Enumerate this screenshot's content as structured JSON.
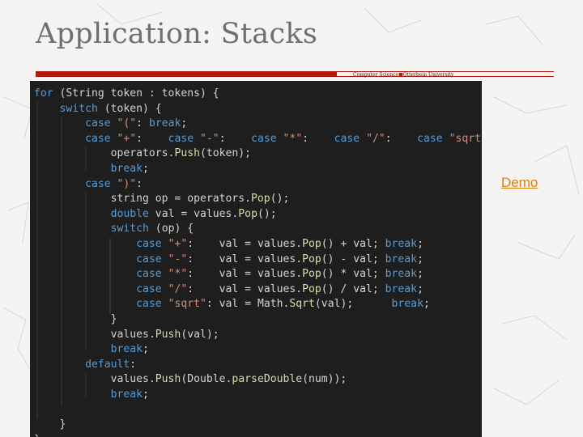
{
  "slide": {
    "title": "Application: Stacks",
    "university_left": "Computer Science",
    "university_sep": "■",
    "university_right": "Otterbein University",
    "demo_link": "Demo"
  },
  "code": {
    "lines": [
      [
        {
          "t": "kw",
          "v": "for"
        },
        {
          "t": "pl",
          "v": " (String token : tokens) {"
        }
      ],
      [
        {
          "t": "pl",
          "v": "    "
        },
        {
          "t": "kw",
          "v": "switch"
        },
        {
          "t": "pl",
          "v": " (token) {"
        }
      ],
      [
        {
          "t": "pl",
          "v": "        "
        },
        {
          "t": "kw",
          "v": "case"
        },
        {
          "t": "pl",
          "v": " "
        },
        {
          "t": "str",
          "v": "\"(\""
        },
        {
          "t": "pl",
          "v": ": "
        },
        {
          "t": "kw",
          "v": "break"
        },
        {
          "t": "pl",
          "v": ";"
        }
      ],
      [
        {
          "t": "pl",
          "v": "        "
        },
        {
          "t": "kw",
          "v": "case"
        },
        {
          "t": "pl",
          "v": " "
        },
        {
          "t": "str",
          "v": "\"+\""
        },
        {
          "t": "pl",
          "v": ":    "
        },
        {
          "t": "kw",
          "v": "case"
        },
        {
          "t": "pl",
          "v": " "
        },
        {
          "t": "str",
          "v": "\"-\""
        },
        {
          "t": "pl",
          "v": ":    "
        },
        {
          "t": "kw",
          "v": "case"
        },
        {
          "t": "pl",
          "v": " "
        },
        {
          "t": "str",
          "v": "\"*\""
        },
        {
          "t": "pl",
          "v": ":    "
        },
        {
          "t": "kw",
          "v": "case"
        },
        {
          "t": "pl",
          "v": " "
        },
        {
          "t": "str",
          "v": "\"/\""
        },
        {
          "t": "pl",
          "v": ":    "
        },
        {
          "t": "kw",
          "v": "case"
        },
        {
          "t": "pl",
          "v": " "
        },
        {
          "t": "str",
          "v": "\"sqrt\""
        },
        {
          "t": "pl",
          "v": ":"
        }
      ],
      [
        {
          "t": "pl",
          "v": "            operators."
        },
        {
          "t": "fn",
          "v": "Push"
        },
        {
          "t": "pl",
          "v": "(token);"
        }
      ],
      [
        {
          "t": "pl",
          "v": "            "
        },
        {
          "t": "kw",
          "v": "break"
        },
        {
          "t": "pl",
          "v": ";"
        }
      ],
      [
        {
          "t": "pl",
          "v": "        "
        },
        {
          "t": "kw",
          "v": "case"
        },
        {
          "t": "pl",
          "v": " "
        },
        {
          "t": "str",
          "v": "\")\""
        },
        {
          "t": "pl",
          "v": ":"
        }
      ],
      [
        {
          "t": "pl",
          "v": "            string op = operators."
        },
        {
          "t": "fn",
          "v": "Pop"
        },
        {
          "t": "pl",
          "v": "();"
        }
      ],
      [
        {
          "t": "pl",
          "v": "            "
        },
        {
          "t": "kw",
          "v": "double"
        },
        {
          "t": "pl",
          "v": " val = values."
        },
        {
          "t": "fn",
          "v": "Pop"
        },
        {
          "t": "pl",
          "v": "();"
        }
      ],
      [
        {
          "t": "pl",
          "v": "            "
        },
        {
          "t": "kw",
          "v": "switch"
        },
        {
          "t": "pl",
          "v": " (op) {"
        }
      ],
      [
        {
          "t": "pl",
          "v": "                "
        },
        {
          "t": "kw",
          "v": "case"
        },
        {
          "t": "pl",
          "v": " "
        },
        {
          "t": "str",
          "v": "\"+\""
        },
        {
          "t": "pl",
          "v": ":    val = values."
        },
        {
          "t": "fn",
          "v": "Pop"
        },
        {
          "t": "pl",
          "v": "() + val; "
        },
        {
          "t": "kw",
          "v": "break"
        },
        {
          "t": "pl",
          "v": ";"
        }
      ],
      [
        {
          "t": "pl",
          "v": "                "
        },
        {
          "t": "kw",
          "v": "case"
        },
        {
          "t": "pl",
          "v": " "
        },
        {
          "t": "str",
          "v": "\"-\""
        },
        {
          "t": "pl",
          "v": ":    val = values."
        },
        {
          "t": "fn",
          "v": "Pop"
        },
        {
          "t": "pl",
          "v": "() - val; "
        },
        {
          "t": "kw",
          "v": "break"
        },
        {
          "t": "pl",
          "v": ";"
        }
      ],
      [
        {
          "t": "pl",
          "v": "                "
        },
        {
          "t": "kw",
          "v": "case"
        },
        {
          "t": "pl",
          "v": " "
        },
        {
          "t": "str",
          "v": "\"*\""
        },
        {
          "t": "pl",
          "v": ":    val = values."
        },
        {
          "t": "fn",
          "v": "Pop"
        },
        {
          "t": "pl",
          "v": "() * val; "
        },
        {
          "t": "kw",
          "v": "break"
        },
        {
          "t": "pl",
          "v": ";"
        }
      ],
      [
        {
          "t": "pl",
          "v": "                "
        },
        {
          "t": "kw",
          "v": "case"
        },
        {
          "t": "pl",
          "v": " "
        },
        {
          "t": "str",
          "v": "\"/\""
        },
        {
          "t": "pl",
          "v": ":    val = values."
        },
        {
          "t": "fn",
          "v": "Pop"
        },
        {
          "t": "pl",
          "v": "() / val; "
        },
        {
          "t": "kw",
          "v": "break"
        },
        {
          "t": "pl",
          "v": ";"
        }
      ],
      [
        {
          "t": "pl",
          "v": "                "
        },
        {
          "t": "kw",
          "v": "case"
        },
        {
          "t": "pl",
          "v": " "
        },
        {
          "t": "str",
          "v": "\"sqrt\""
        },
        {
          "t": "pl",
          "v": ": val = Math."
        },
        {
          "t": "fn",
          "v": "Sqrt"
        },
        {
          "t": "pl",
          "v": "(val);      "
        },
        {
          "t": "kw",
          "v": "break"
        },
        {
          "t": "pl",
          "v": ";"
        }
      ],
      [
        {
          "t": "pl",
          "v": "            }"
        }
      ],
      [
        {
          "t": "pl",
          "v": "            values."
        },
        {
          "t": "fn",
          "v": "Push"
        },
        {
          "t": "pl",
          "v": "(val);"
        }
      ],
      [
        {
          "t": "pl",
          "v": "            "
        },
        {
          "t": "kw",
          "v": "break"
        },
        {
          "t": "pl",
          "v": ";"
        }
      ],
      [
        {
          "t": "pl",
          "v": "        "
        },
        {
          "t": "kw",
          "v": "default"
        },
        {
          "t": "pl",
          "v": ":"
        }
      ],
      [
        {
          "t": "pl",
          "v": "            values."
        },
        {
          "t": "fn",
          "v": "Push"
        },
        {
          "t": "pl",
          "v": "(Double."
        },
        {
          "t": "fn",
          "v": "parseDouble"
        },
        {
          "t": "pl",
          "v": "(num));"
        }
      ],
      [
        {
          "t": "pl",
          "v": "            "
        },
        {
          "t": "kw",
          "v": "break"
        },
        {
          "t": "pl",
          "v": ";"
        }
      ],
      [
        {
          "t": "pl",
          "v": ""
        }
      ],
      [
        {
          "t": "pl",
          "v": "    }"
        }
      ],
      [
        {
          "t": "pl",
          "v": "}"
        }
      ]
    ]
  },
  "colors": {
    "accent_red": "#b21a0f",
    "link_orange": "#e07b0f",
    "code_bg": "#1e1e1e",
    "keyword": "#569cd6",
    "string": "#ce9178",
    "function": "#dcdcaa",
    "plain": "#d4d4d4"
  }
}
